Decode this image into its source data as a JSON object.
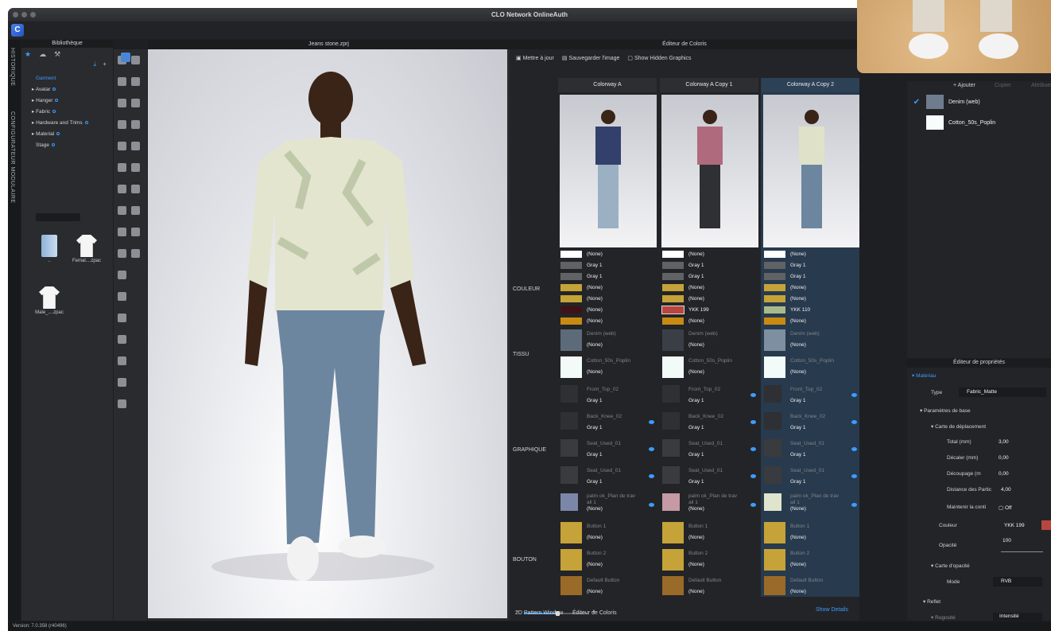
{
  "window": {
    "title": "CLO Network OnlineAuth"
  },
  "sidetabs": [
    "HISTORIQUE",
    "CONFIGURATEUR MODULAIRE"
  ],
  "library": {
    "title": "Bibliothèque",
    "tree": [
      "Garment",
      "Avatar",
      "Hanger",
      "Fabric",
      "Hardware and Trims",
      "Material",
      "Stage"
    ],
    "files": [
      "..",
      "Femal....zpac",
      "Male_....zpac"
    ]
  },
  "viewport": {
    "title": "Jeans stone.zprj"
  },
  "colorway_editor": {
    "title": "Éditeur de Coloris",
    "toolbar": [
      "Mettre à jour",
      "Sauvegarder l'image",
      "Show Hidden Graphics"
    ],
    "columns": [
      "Colorway A",
      "Colorway A Copy 1",
      "Colorway A Copy 2"
    ],
    "sections": [
      "COULEUR",
      "TISSU",
      "GRAPHIQUE",
      "BOUTON"
    ],
    "couleur": [
      {
        "a": "(None)",
        "b": "(None)",
        "c": "(None)"
      },
      {
        "a": "Gray 1",
        "b": "Gray 1",
        "c": "Gray 1"
      },
      {
        "a": "Gray 1",
        "b": "Gray 1",
        "c": "Gray 1"
      },
      {
        "a": "(None)",
        "b": "(None)",
        "c": "(None)"
      },
      {
        "a": "(None)",
        "b": "(None)",
        "c": "(None)"
      },
      {
        "a": "(None)",
        "b": "YKK 199",
        "c": "YKK 110"
      },
      {
        "a": "(None)",
        "b": "(None)",
        "c": "(None)"
      }
    ],
    "tissu": [
      {
        "name": "Denim (web)",
        "value": "(None)"
      },
      {
        "name": "Cotton_50s_Poplin",
        "value": "(None)"
      }
    ],
    "graphique": [
      {
        "name": "Front_Top_02",
        "value": "Gray 1"
      },
      {
        "name": "Back_Knee_02",
        "value": "Gray 1"
      },
      {
        "name": "Seat_Used_01",
        "value": "Gray 1"
      },
      {
        "name": "Seat_Used_01",
        "value": "Gray 1"
      },
      {
        "name": "palm ok_Plan de trav",
        "name2": "ail 1",
        "value": "(None)"
      }
    ],
    "bouton": [
      {
        "name": "Button 1",
        "value": "(None)"
      },
      {
        "name": "Button 2",
        "value": "(None)"
      },
      {
        "name": "Default Button",
        "value": "(None)"
      }
    ],
    "show_details": "Show Details",
    "bottom_tabs": [
      "2D Pattern Window",
      "Éditeur de Coloris"
    ]
  },
  "materials": {
    "toolbar": [
      "+ Ajouter",
      "Copier",
      "Attribuer"
    ],
    "items": [
      "Denim (web)",
      "Cotton_50s_Poplin"
    ]
  },
  "properties": {
    "title": "Éditeur de propriétés",
    "section": "Matériau",
    "type_label": "Type",
    "type_value": "Fabric_Matte",
    "base": "Paramètres de base",
    "displacement": "Carte de déplacement",
    "fields": [
      {
        "label": "Total (mm)",
        "value": "3,00"
      },
      {
        "label": "Décaler (mm)",
        "value": "0,00"
      },
      {
        "label": "Découpage (m",
        "value": "0,00"
      },
      {
        "label": "Distance des Partic",
        "value": "4,00"
      }
    ],
    "keep_label": "Maintenir la conti",
    "keep_value": "Off",
    "color_label": "Couleur",
    "color_value": "YKK 199",
    "opacity_label": "Opacité",
    "opacity_value": "100",
    "opacity_map": "Carte d'opacité",
    "mode_label": "Mode",
    "mode_value": "RVB",
    "reflect": "Reflet",
    "rugosity": "Rugosité",
    "intensity": "Intensité"
  },
  "status": "Version: 7.0.358 (r40496)",
  "colors": {
    "accent": "#3c9cff",
    "ykk199": "#b8463f",
    "ykk110": "#a9b98c",
    "gold": "#c5a339"
  }
}
